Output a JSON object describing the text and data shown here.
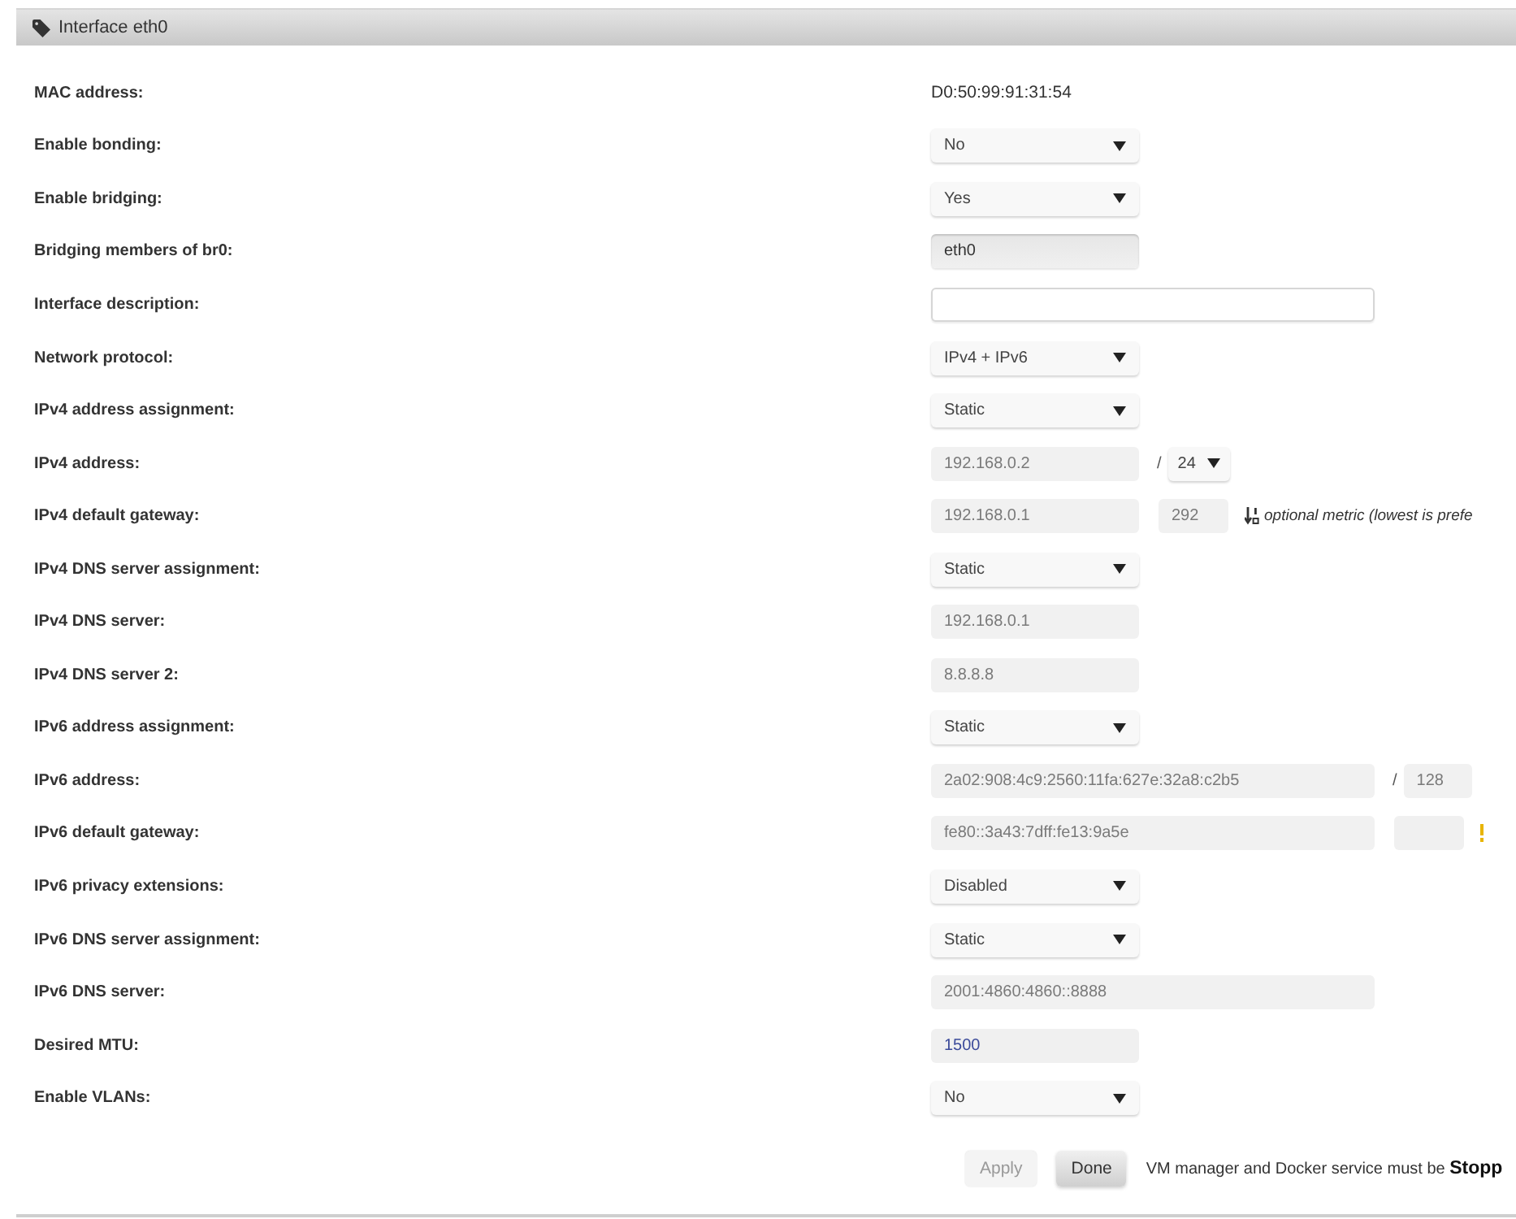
{
  "panel": {
    "title": "Interface eth0"
  },
  "rows": [
    {
      "label": "MAC address:",
      "kind": "text",
      "value": "D0:50:99:91:31:54"
    },
    {
      "label": "Enable bonding:",
      "kind": "select",
      "value": "No"
    },
    {
      "label": "Enable bridging:",
      "kind": "select",
      "value": "Yes"
    },
    {
      "label": "Bridging members of br0:",
      "kind": "list",
      "value": "eth0"
    },
    {
      "label": "Interface description:",
      "kind": "text-box"
    },
    {
      "label": "Network protocol:",
      "kind": "select",
      "value": "IPv4 + IPv6"
    },
    {
      "label": "IPv4 address assignment:",
      "kind": "select",
      "value": "Static"
    },
    {
      "label": "IPv4 address:",
      "kind": "input",
      "value": "192.168.0.2",
      "disabled": true,
      "suffix": {
        "separator": "/",
        "kind": "select",
        "value": "24"
      }
    },
    {
      "label": "IPv4 default gateway:",
      "kind": "input",
      "value": "192.168.0.1",
      "disabled": true,
      "metric": {
        "value": "292",
        "disabled": true,
        "kind": "sort",
        "hint": "optional metric (lowest is prefe"
      }
    },
    {
      "label": "IPv4 DNS server assignment:",
      "kind": "select",
      "value": "Static"
    },
    {
      "label": "IPv4 DNS server:",
      "kind": "input",
      "value": "192.168.0.1",
      "disabled": true
    },
    {
      "label": "IPv4 DNS server 2:",
      "kind": "input",
      "value": "8.8.8.8",
      "disabled": true
    },
    {
      "label": "IPv6 address assignment:",
      "kind": "select",
      "value": "Static"
    },
    {
      "label": "IPv6 address:",
      "kind": "wide-input",
      "value": "2a02:908:4c9:2560:11fa:627e:32a8:c2b5",
      "disabled": true,
      "suffix": {
        "separator": "/",
        "kind": "input",
        "value": "128",
        "disabled": true
      }
    },
    {
      "label": "IPv6 default gateway:",
      "kind": "wide-input",
      "value": "fe80::3a43:7dff:fe13:9a5e",
      "disabled": true,
      "metric": {
        "kind": "warning"
      }
    },
    {
      "label": "IPv6 privacy extensions:",
      "kind": "select",
      "value": "Disabled"
    },
    {
      "label": "IPv6 DNS server assignment:",
      "kind": "select",
      "value": "Static"
    },
    {
      "label": "IPv6 DNS server:",
      "kind": "wide-input",
      "value": "2001:4860:4860::8888",
      "disabled": true
    },
    {
      "label": "Desired MTU:",
      "kind": "input",
      "value": "1500",
      "disabled": false
    },
    {
      "label": "Enable VLANs:",
      "kind": "select",
      "value": "No"
    }
  ],
  "buttons": [
    {
      "label": "Apply",
      "disabled": true
    },
    {
      "label": "Done",
      "disabled": false
    }
  ],
  "note": "VM manager and Docker service must be **Stopp**"
}
